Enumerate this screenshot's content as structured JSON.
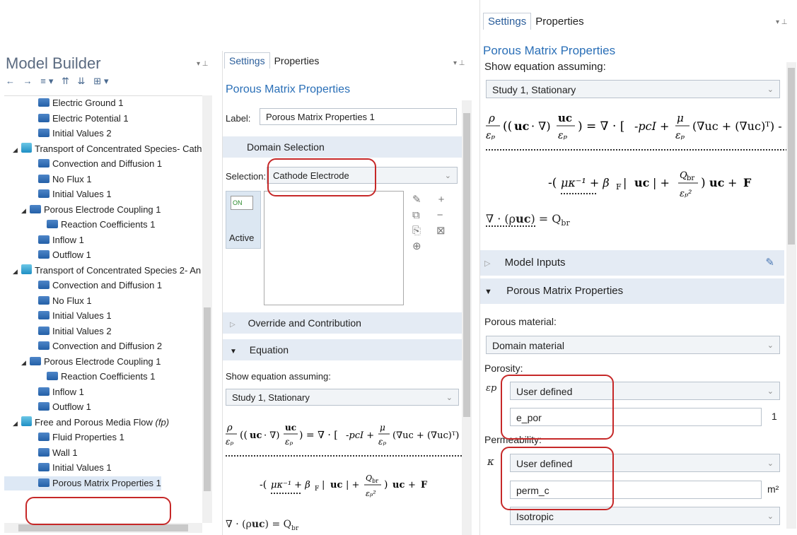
{
  "model_builder": {
    "title": "Model Builder",
    "toolbar_glyphs": [
      "←",
      "→",
      "≡▾",
      "⇈",
      "⇊",
      "⊞▾"
    ],
    "tree": [
      {
        "label": "Electric Ground 1",
        "indent": 3,
        "expander": ""
      },
      {
        "label": "Electric Potential 1",
        "indent": 3,
        "expander": ""
      },
      {
        "label": "Initial Values 2",
        "indent": 3,
        "expander": ""
      },
      {
        "label": "Transport of Concentrated Species- Cath",
        "indent": 1,
        "expander": "◢",
        "phys": true
      },
      {
        "label": "Convection and Diffusion 1",
        "indent": 3,
        "expander": ""
      },
      {
        "label": "No Flux 1",
        "indent": 3,
        "expander": ""
      },
      {
        "label": "Initial Values 1",
        "indent": 3,
        "expander": ""
      },
      {
        "label": "Porous Electrode Coupling 1",
        "indent": 2,
        "expander": "◢"
      },
      {
        "label": "Reaction Coefficients 1",
        "indent": 4,
        "expander": ""
      },
      {
        "label": "Inflow 1",
        "indent": 3,
        "expander": ""
      },
      {
        "label": "Outflow 1",
        "indent": 3,
        "expander": ""
      },
      {
        "label": "Transport of Concentrated Species 2- An",
        "indent": 1,
        "expander": "◢",
        "phys": true
      },
      {
        "label": "Convection and Diffusion 1",
        "indent": 3,
        "expander": ""
      },
      {
        "label": "No Flux 1",
        "indent": 3,
        "expander": ""
      },
      {
        "label": "Initial Values 1",
        "indent": 3,
        "expander": ""
      },
      {
        "label": "Initial Values 2",
        "indent": 3,
        "expander": ""
      },
      {
        "label": "Convection and Diffusion 2",
        "indent": 3,
        "expander": ""
      },
      {
        "label": "Porous Electrode Coupling 1",
        "indent": 2,
        "expander": "◢"
      },
      {
        "label": "Reaction Coefficients 1",
        "indent": 4,
        "expander": ""
      },
      {
        "label": "Inflow 1",
        "indent": 3,
        "expander": ""
      },
      {
        "label": "Outflow 1",
        "indent": 3,
        "expander": ""
      },
      {
        "label": "Free and Porous Media Flow ",
        "tag": "(fp)",
        "indent": 1,
        "expander": "◢",
        "phys": true
      },
      {
        "label": "Fluid Properties 1",
        "indent": 3,
        "expander": ""
      },
      {
        "label": "Wall 1",
        "indent": 3,
        "expander": ""
      },
      {
        "label": "Initial Values 1",
        "indent": 3,
        "expander": ""
      },
      {
        "label": "Porous Matrix Properties 1",
        "indent": 3,
        "expander": "",
        "selected": true
      }
    ]
  },
  "middle": {
    "tabs": [
      "Settings",
      "Properties"
    ],
    "title": "Porous Matrix Properties",
    "label_caption": "Label:",
    "label_value": "Porous Matrix Properties 1",
    "domain_selection": "Domain Selection",
    "selection_caption": "Selection:",
    "selection_value": "Cathode Electrode",
    "toggle_on": "ON",
    "active_label": "Active",
    "override_section": "Override and Contribution",
    "equation_section": "Equation",
    "show_eq_caption": "Show equation assuming:",
    "study_value": "Study 1, Stationary"
  },
  "right": {
    "tabs": [
      "Settings",
      "Properties"
    ],
    "title": "Porous Matrix Properties",
    "show_eq_caption": "Show equation assuming:",
    "study_value": "Study 1, Stationary",
    "model_inputs": "Model Inputs",
    "porous_section": "Porous Matrix Properties",
    "porous_material_caption": "Porous material:",
    "porous_material_value": "Domain material",
    "porosity_caption": "Porosity:",
    "porosity_symbol": "εp",
    "porosity_mode": "User defined",
    "porosity_value": "e_por",
    "porosity_unit": "1",
    "permeability_caption": "Permeability:",
    "permeability_symbol": "κ",
    "permeability_mode": "User defined",
    "permeability_value": "perm_c",
    "permeability_unit": "m²",
    "isotropic_value": "Isotropic"
  },
  "colors": {
    "accent": "#2a6fb7",
    "section_bg": "#e4ebf4",
    "highlight": "#c62828"
  }
}
